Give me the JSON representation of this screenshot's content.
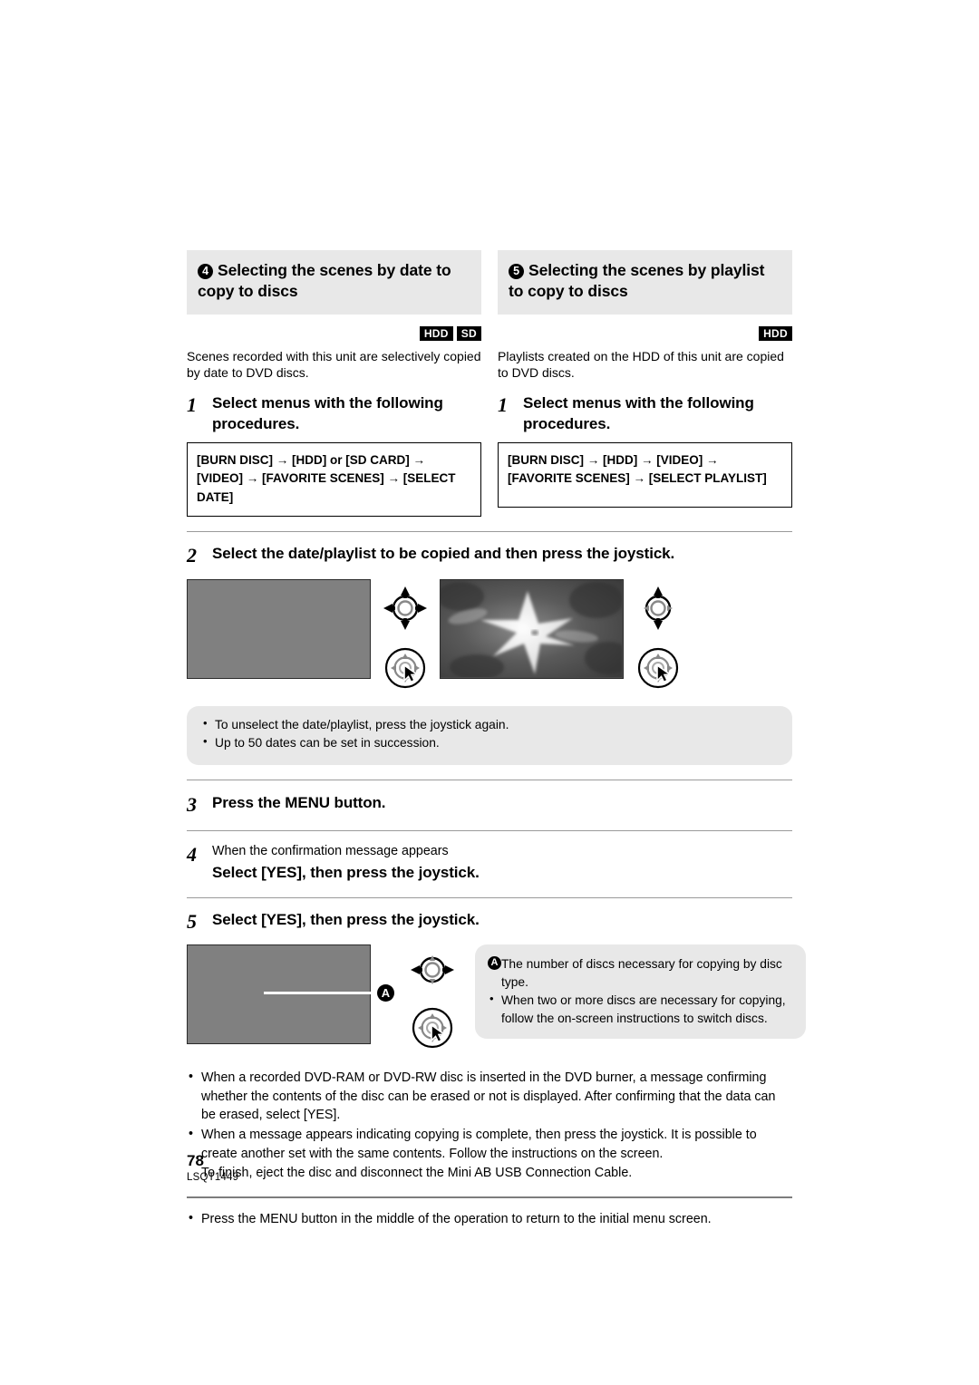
{
  "page": {
    "number": "78",
    "doc_id": "LSQT1449"
  },
  "sections": [
    {
      "marker": "4",
      "title": "Selecting the scenes by date to copy to discs",
      "badges": [
        "HDD",
        "SD"
      ],
      "lead": "Scenes recorded with this unit are selectively copied by date to DVD discs.",
      "step_number": "1",
      "step_text": "Select menus with the following procedures.",
      "menu_path": "[BURN DISC] → [HDD] or [SD CARD] → [VIDEO] → [FAVORITE SCENES] → [SELECT DATE]"
    },
    {
      "marker": "5",
      "title": "Selecting the scenes by playlist to copy to discs",
      "badges": [
        "HDD"
      ],
      "lead": "Playlists created on the HDD of this unit are copied to DVD discs.",
      "step_number": "1",
      "step_text": "Select menus with the following procedures.",
      "menu_path": "[BURN DISC] → [HDD] → [VIDEO] → [FAVORITE SCENES] → [SELECT PLAYLIST]"
    }
  ],
  "step2": {
    "number": "2",
    "text": "Select the date/playlist to be copied and then press the joystick.",
    "notes": [
      "To unselect the date/playlist, press the joystick again.",
      "Up to 50 dates can be set in succession."
    ]
  },
  "step3": {
    "number": "3",
    "text": "Press the MENU button."
  },
  "step4": {
    "number": "4",
    "condition": "When the confirmation message appears",
    "text": "Select [YES], then press the joystick."
  },
  "step5": {
    "number": "5",
    "text": "Select [YES], then press the joystick.",
    "callout_marker": "A",
    "callout_text": "The number of discs necessary for copying by disc type.",
    "note": "When two or more discs are necessary for copying, follow the on-screen instructions to switch discs."
  },
  "bottom_notes": [
    "When a recorded DVD-RAM or DVD-RW disc is inserted in the DVD burner, a message confirming whether the contents of the disc can be erased or not is displayed. After confirming that the data can be erased, select [YES].",
    "When a message appears indicating copying is complete, then press the joystick. It is possible to create another set with the same contents. Follow the instructions on the screen.",
    "To finish, eject the disc and disconnect the Mini AB USB Connection Cable."
  ],
  "final_note": "Press the MENU button in the middle of the operation to return to the initial menu screen.",
  "colors": {
    "header_bg": "#e8e8e8",
    "note_bg": "#e8e8e8",
    "screenshot_gray": "#808080",
    "rule": "#9a9a9a"
  }
}
